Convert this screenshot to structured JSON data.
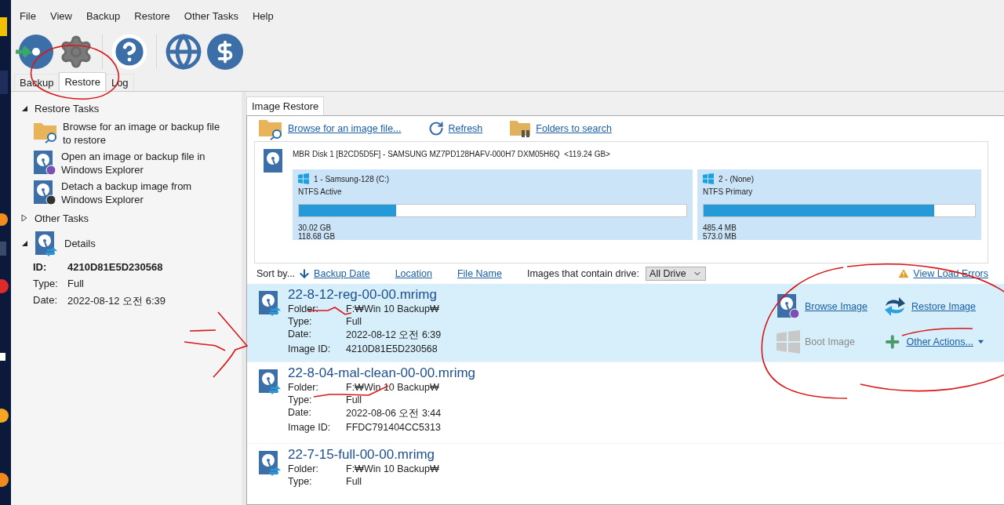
{
  "menu": [
    "File",
    "View",
    "Backup",
    "Restore",
    "Other Tasks",
    "Help"
  ],
  "tabs": [
    {
      "label": "Backup",
      "selected": false
    },
    {
      "label": "Restore",
      "selected": true
    },
    {
      "label": "Log",
      "selected": false
    }
  ],
  "restore_tasks": {
    "title": "Restore Tasks",
    "expanded": true,
    "items": [
      {
        "label": "Browse for an image or backup file to restore",
        "kind": "folder"
      },
      {
        "label": "Open an image or backup file in Windows Explorer",
        "kind": "open"
      },
      {
        "label": "Detach a backup image from Windows Explorer",
        "kind": "detach"
      }
    ]
  },
  "other_tasks": {
    "title": "Other Tasks",
    "expanded": false
  },
  "details": {
    "title": "Details",
    "expanded": true,
    "fields": [
      {
        "label": "ID:",
        "value": "4210D81E5D230568",
        "emphasis": true
      },
      {
        "label": "Type:",
        "value": "Full",
        "emphasis": false
      },
      {
        "label": "Date:",
        "value": "2022-08-12 오전 6:39",
        "emphasis": false
      }
    ]
  },
  "panel_tab": "Image Restore",
  "links": [
    {
      "label": "Browse for an image file...",
      "kind": "browse"
    },
    {
      "label": "Refresh",
      "kind": "refresh"
    },
    {
      "label": "Folders to search",
      "kind": "folders"
    }
  ],
  "disk": {
    "title": "MBR Disk 1 [B2CD5D5F] - SAMSUNG MZ7PD128HAFV-000H7 DXM05H6Q  <119.24 GB>",
    "partitions": [
      {
        "name": "1 - Samsung-128 (C:)",
        "type": "NTFS Active",
        "level": 0.25,
        "used": "30.02 GB",
        "total": "118.68 GB"
      },
      {
        "name": "2 -  (None)",
        "type": "NTFS Primary",
        "level": 0.85,
        "used": "485.4 MB",
        "total": "573.0 MB"
      }
    ]
  },
  "sort": {
    "label": "Sort by...",
    "columns": [
      {
        "label": "Backup Date",
        "selected": true
      },
      {
        "label": "Location",
        "selected": false
      },
      {
        "label": "File Name",
        "selected": false
      }
    ],
    "filter_label": "Images that contain drive:",
    "filter_value": "All Drive",
    "errors_link": "View Load Errors"
  },
  "images": [
    {
      "name": "22-8-12-reg-00-00.mrimg",
      "selected": true,
      "fields": [
        {
          "label": "Folder:",
          "value": "F:₩Win 10 Backup₩"
        },
        {
          "label": "Type:",
          "value": "Full"
        },
        {
          "label": "Date:",
          "value": "2022-08-12 오전 6:39"
        },
        {
          "label": "Image ID:",
          "value": "4210D81E5D230568"
        }
      ]
    },
    {
      "name": "22-8-04-mal-clean-00-00.mrimg",
      "selected": false,
      "fields": [
        {
          "label": "Folder:",
          "value": "F:₩Win 10 Backup₩"
        },
        {
          "label": "Type:",
          "value": "Full"
        },
        {
          "label": "Date:",
          "value": "2022-08-06 오전 3:44"
        },
        {
          "label": "Image ID:",
          "value": "FFDC791404CC5313"
        }
      ]
    },
    {
      "name": "22-7-15-full-00-00.mrimg",
      "selected": false,
      "fields": [
        {
          "label": "Folder:",
          "value": "F:₩Win 10 Backup₩"
        },
        {
          "label": "Type:",
          "value": "Full"
        }
      ]
    }
  ],
  "actions": [
    {
      "label": "Browse Image",
      "kind": "browse",
      "disabled": false
    },
    {
      "label": "Restore Image",
      "kind": "restore",
      "disabled": false
    },
    {
      "label": "Boot Image",
      "kind": "boot",
      "disabled": true
    },
    {
      "label": "Other Actions...",
      "kind": "more",
      "disabled": false
    }
  ]
}
